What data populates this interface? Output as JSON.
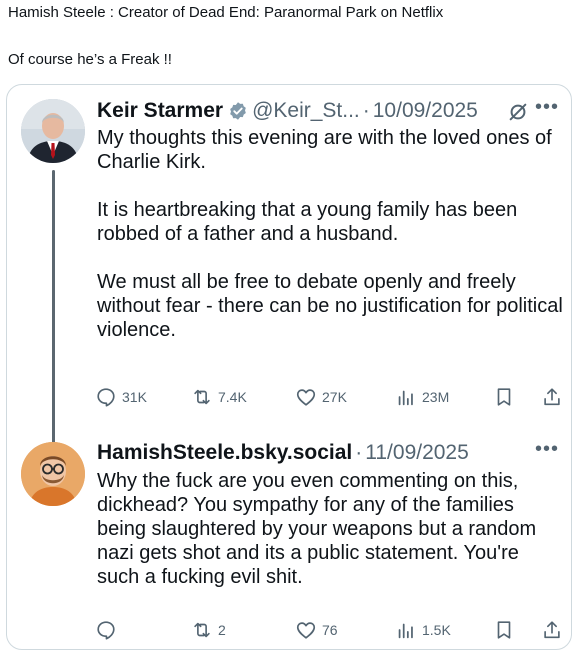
{
  "post": {
    "line1": "Hamish Steele : Creator of Dead End: Paranormal Park on Netflix",
    "line2": "Of course he’s a Freak !!"
  },
  "tweets": [
    {
      "name": "Keir Starmer",
      "handle": "@Keir_St...",
      "separator": "·",
      "date": "10/09/2025",
      "verified": true,
      "badge_color": "#829aab",
      "paragraphs": [
        "My thoughts this evening are with the loved ones of Charlie Kirk.",
        "It is heartbreaking that a young family has been robbed of a father and a husband.",
        "We must all be free to debate openly and freely without fear - there can be no justification for political violence."
      ],
      "more_icon": "more-horizontal-icon",
      "stats": {
        "replies": "31K",
        "reposts": "7.4K",
        "likes": "27K",
        "views": "23M"
      }
    },
    {
      "name": "HamishSteele.bsky.social",
      "separator": "·",
      "date": "11/09/2025",
      "paragraphs": [
        "Why the fuck are you even commenting on this, dickhead? You sympathy for any of the families being slaughtered by your weapons but a random nazi gets shot and its a public statement. You're such a fucking evil shit."
      ],
      "more_icon": "more-horizontal-icon",
      "stats": {
        "replies": "",
        "reposts": "2",
        "likes": "76",
        "views": "1.5K"
      }
    }
  ],
  "colors": {
    "text": "#0f1419",
    "secondary": "#536471",
    "border": "#cfd9de",
    "thread_line": "#5b6770"
  }
}
